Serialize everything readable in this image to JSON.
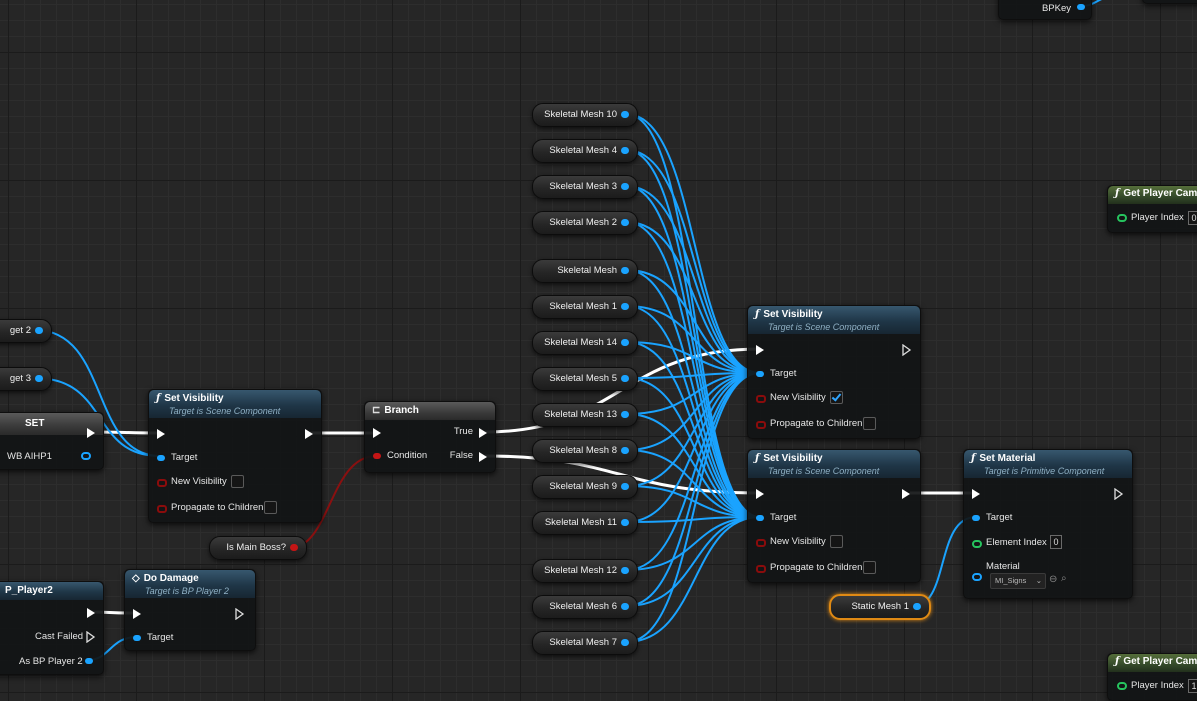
{
  "colors": {
    "object_pin": "#1aa3ff",
    "bool_pin": "#c41515",
    "int_pin": "#26c35e",
    "exec": "#ffffff",
    "selected": "#e08a14"
  },
  "top_node": {
    "pin_label": "BPKey"
  },
  "left_vars": {
    "target2": "get 2",
    "target3": "get 3"
  },
  "set_node": {
    "title": "SET",
    "value_label": "WB AIHP1"
  },
  "set_visibility_left": {
    "title": "Set Visibility",
    "subtitle": "Target is Scene Component",
    "target": "Target",
    "new_visibility": "New Visibility",
    "propagate": "Propagate to Children"
  },
  "branch": {
    "title": "Branch",
    "condition": "Condition",
    "true": "True",
    "false": "False"
  },
  "is_main_boss": "Is Main Boss?",
  "cast_node": {
    "title": "P_Player2",
    "cast_failed": "Cast Failed",
    "as_bp": "As BP Player 2"
  },
  "do_damage": {
    "title": "Do Damage",
    "subtitle": "Target is BP Player 2",
    "target": "Target"
  },
  "skeletal_meshes": [
    "Skeletal Mesh 10",
    "Skeletal Mesh 4",
    "Skeletal Mesh 3",
    "Skeletal Mesh 2",
    "Skeletal Mesh",
    "Skeletal Mesh 1",
    "Skeletal Mesh 14",
    "Skeletal Mesh 5",
    "Skeletal Mesh 13",
    "Skeletal Mesh 8",
    "Skeletal Mesh 9",
    "Skeletal Mesh 11",
    "Skeletal Mesh 12",
    "Skeletal Mesh 6",
    "Skeletal Mesh 7"
  ],
  "set_visibility_a": {
    "title": "Set Visibility",
    "subtitle": "Target is Scene Component",
    "target": "Target",
    "new_visibility": "New Visibility",
    "new_visibility_checked": true,
    "propagate": "Propagate to Children"
  },
  "set_visibility_b": {
    "title": "Set Visibility",
    "subtitle": "Target is Scene Component",
    "target": "Target",
    "new_visibility": "New Visibility",
    "new_visibility_checked": false,
    "propagate": "Propagate to Children"
  },
  "set_material": {
    "title": "Set Material",
    "subtitle": "Target is Primitive Component",
    "target": "Target",
    "element_index": "Element Index",
    "element_index_value": "0",
    "material": "Material",
    "material_value": "MI_Signs"
  },
  "static_mesh": "Static Mesh 1",
  "get_player_camera_1": {
    "title": "Get Player Came",
    "player_index": "Player Index",
    "value": "0"
  },
  "get_player_camera_2": {
    "title": "Get Player Came",
    "player_index": "Player Index",
    "value": "1"
  }
}
